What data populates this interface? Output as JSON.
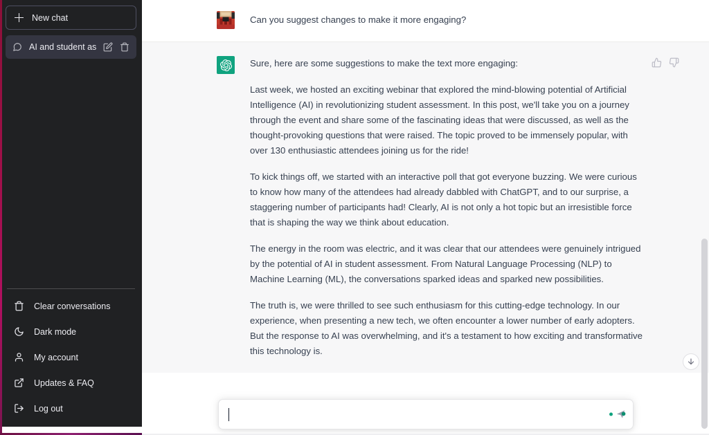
{
  "sidebar": {
    "new_chat_label": "New chat",
    "conversations": [
      {
        "title": "AI and student assess",
        "icon": "chat-bubble-icon",
        "edit_icon": "pencil-icon",
        "delete_icon": "trash-icon",
        "active": true
      }
    ],
    "menu": [
      {
        "label": "Clear conversations",
        "icon": "trash-icon"
      },
      {
        "label": "Dark mode",
        "icon": "moon-icon"
      },
      {
        "label": "My account",
        "icon": "user-icon"
      },
      {
        "label": "Updates & FAQ",
        "icon": "external-link-icon"
      },
      {
        "label": "Log out",
        "icon": "logout-icon"
      }
    ]
  },
  "conversation": {
    "user_message": {
      "avatar": "user-avatar-pixel",
      "text": "Can you suggest changes to make it more engaging?"
    },
    "assistant_message": {
      "avatar": "openai-logo-icon",
      "intro": "Sure, here are some suggestions to make the text more engaging:",
      "paragraphs": [
        "Last week, we hosted an exciting webinar that explored the mind-blowing potential of Artificial Intelligence (AI) in revolutionizing student assessment. In this post, we'll take you on a journey through the event and share some of the fascinating ideas that were discussed, as well as the thought-provoking questions that were raised. The topic proved to be immensely popular, with over 130 enthusiastic attendees joining us for the ride!",
        "To kick things off, we started with an interactive poll that got everyone buzzing. We were curious to know how many of the attendees had already dabbled with ChatGPT, and to our surprise, a staggering number of participants had! Clearly, AI is not only a hot topic but an irresistible force that is shaping the way we think about education.",
        "The energy in the room was electric, and it was clear that our attendees were genuinely intrigued by the potential of AI in student assessment. From Natural Language Processing (NLP) to Machine Learning (ML), the conversations sparked ideas and sparked new possibilities.",
        "The truth is, we were thrilled to see such enthusiasm for this cutting-edge technology. In our experience, when presenting a new tech, we often encounter a lower number of early adopters. But the response to AI was overwhelming, and it's a testament to how exciting and transformative this technology is."
      ],
      "feedback": {
        "thumbs_up_icon": "thumbs-up-icon",
        "thumbs_down_icon": "thumbs-down-icon"
      }
    }
  },
  "composer": {
    "value": "",
    "placeholder": "",
    "send_icon": "send-icon"
  },
  "controls": {
    "scroll_down_icon": "arrow-down-icon"
  },
  "colors": {
    "sidebar_bg": "#202123",
    "active_item_bg": "#343541",
    "assistant_bg": "#f7f7f8",
    "brand_green": "#10a37f",
    "body_text": "#374151",
    "accent_edge": "#a0104a"
  }
}
